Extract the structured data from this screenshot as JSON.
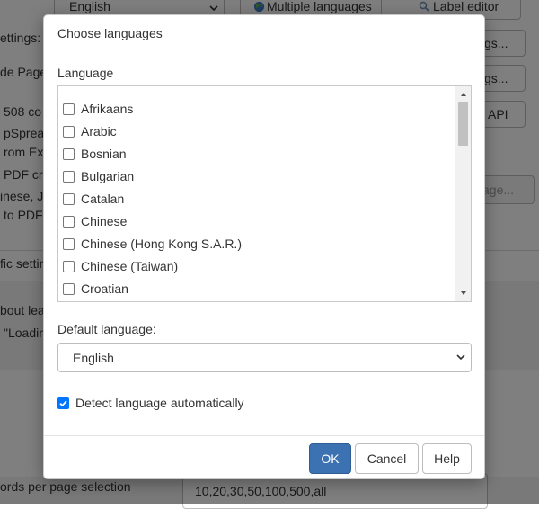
{
  "background": {
    "top_select_value": "English",
    "multiple_languages_label": "Multiple languages",
    "label_editor_label": "Label editor",
    "btn_1_fragment": "gs...",
    "btn_2_fragment": "gs...",
    "btn_api_fragment": "API",
    "btn_page_fragment": "age...",
    "left_lines": [
      "ettings:",
      "de Page",
      "508 co",
      "pSpread",
      "rom Exc",
      "PDF cre",
      "inese, J",
      "to PDF"
    ],
    "section_fragment": "fic settin",
    "about_fragment": "bout lea",
    "loading_fragment": "\"Loadin",
    "records_label": "ords per page selection",
    "records_value": "10,20,30,50,100,500,all"
  },
  "dialog": {
    "title": "Choose languages",
    "language_label": "Language",
    "languages": [
      "Afrikaans",
      "Arabic",
      "Bosnian",
      "Bulgarian",
      "Catalan",
      "Chinese",
      "Chinese (Hong Kong S.A.R.)",
      "Chinese (Taiwan)",
      "Croatian"
    ],
    "default_language_label": "Default language:",
    "default_language_value": "English",
    "detect_label": "Detect language automatically",
    "detect_checked": true,
    "ok_label": "OK",
    "cancel_label": "Cancel",
    "help_label": "Help"
  },
  "colors": {
    "primary_button": "#3c72b1",
    "checkbox_checked": "#0075ff",
    "overlay": "rgba(0,0,0,0.5)"
  }
}
